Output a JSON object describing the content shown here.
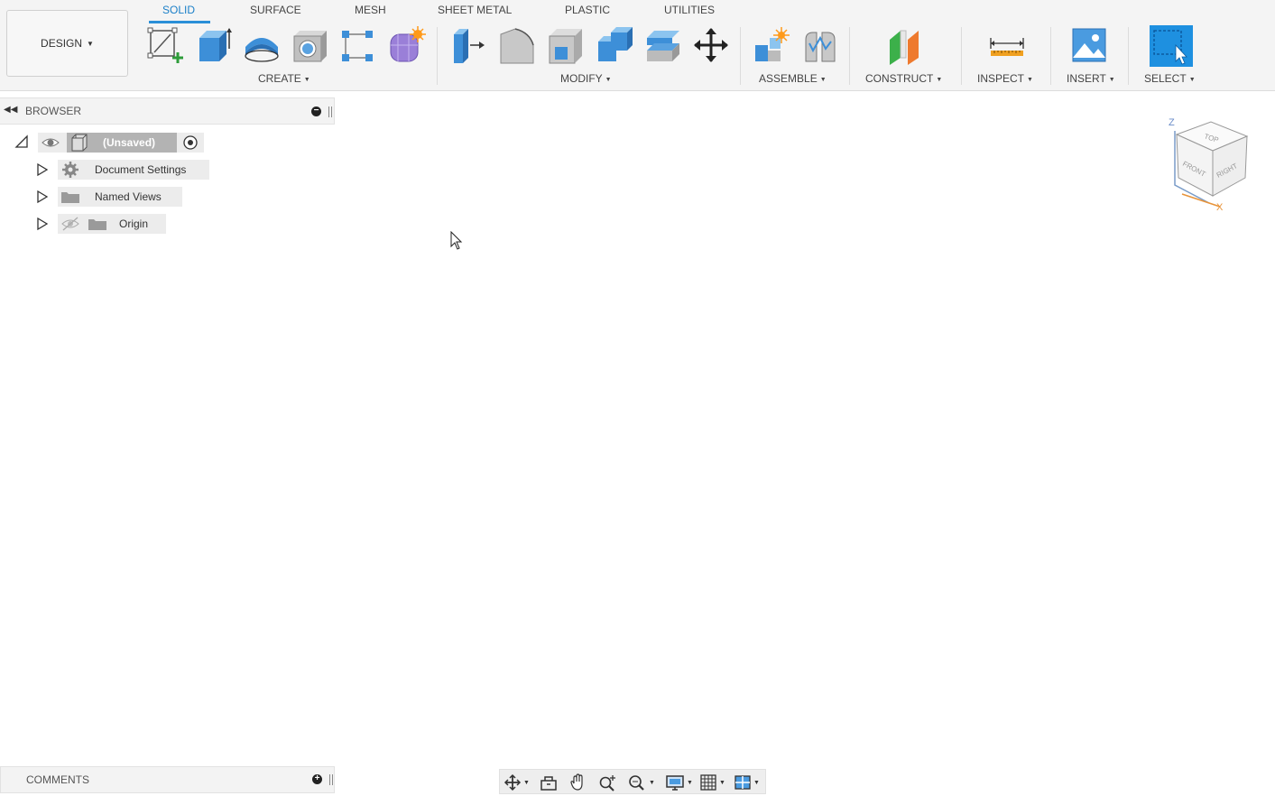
{
  "workspace": {
    "label": "DESIGN"
  },
  "tabs": [
    {
      "label": "SOLID",
      "active": true
    },
    {
      "label": "SURFACE",
      "active": false
    },
    {
      "label": "MESH",
      "active": false
    },
    {
      "label": "SHEET METAL",
      "active": false
    },
    {
      "label": "PLASTIC",
      "active": false
    },
    {
      "label": "UTILITIES",
      "active": false
    }
  ],
  "groups": {
    "create": "CREATE",
    "modify": "MODIFY",
    "assemble": "ASSEMBLE",
    "construct": "CONSTRUCT",
    "inspect": "INSPECT",
    "insert": "INSERT",
    "select": "SELECT"
  },
  "browser": {
    "title": "BROWSER",
    "root": "(Unsaved)",
    "items": [
      {
        "label": "Document Settings",
        "icon": "gear-icon"
      },
      {
        "label": "Named Views",
        "icon": "folder-icon"
      },
      {
        "label": "Origin",
        "icon": "folder-icon",
        "hidden": true
      }
    ]
  },
  "comments": {
    "title": "COMMENTS"
  },
  "viewcube": {
    "top": "TOP",
    "front": "FRONT",
    "right": "RIGHT",
    "axis_z": "Z",
    "axis_x": "X"
  },
  "colors": {
    "accent": "#1a7fc8",
    "select_blue": "#1e90e0",
    "tool_blue": "#4a9be0"
  }
}
